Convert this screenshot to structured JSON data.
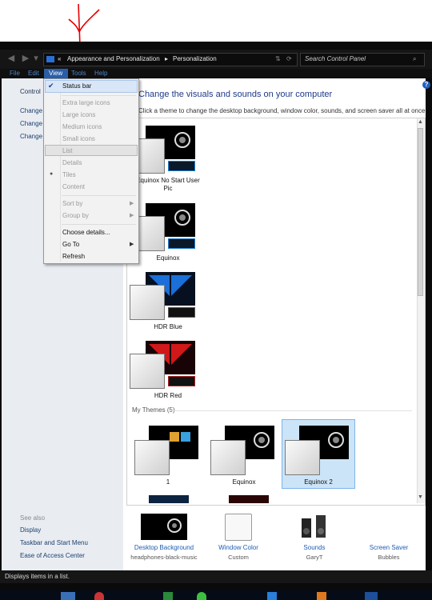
{
  "address": {
    "crumb1": "Appearance and Personalization",
    "crumb2": "Personalization",
    "search_placeholder": "Search Control Panel"
  },
  "menubar": {
    "file": "File",
    "edit": "Edit",
    "view": "View",
    "tools": "Tools",
    "help": "Help"
  },
  "left_pane": {
    "control_label": "Control",
    "links": [
      "Change",
      "Change",
      "Change"
    ],
    "see_also": "See also",
    "see_also_links": [
      "Display",
      "Taskbar and Start Menu",
      "Ease of Access Center"
    ]
  },
  "main": {
    "title": "Change the visuals and sounds on your computer",
    "subtitle": "Click a theme to change the desktop background, window color, sounds, and screen saver all at once.",
    "themes": [
      {
        "label_line1": "Equinox No Start User",
        "label_line2": "Pic"
      },
      {
        "label_line1": "Equinox",
        "label_line2": ""
      },
      {
        "label_line1": "HDR Blue",
        "label_line2": ""
      },
      {
        "label_line1": "HDR Red",
        "label_line2": ""
      }
    ],
    "my_themes_label": "My Themes (5)",
    "my_themes": [
      "1",
      "Equinox",
      "Equinox 2"
    ],
    "selected_theme": "Equinox 2"
  },
  "bottom": {
    "desktop_background": {
      "label": "Desktop Background",
      "sub": "headphones-black-music"
    },
    "window_color": {
      "label": "Window Color",
      "sub": "Custom"
    },
    "sounds": {
      "label": "Sounds",
      "sub": "GaryT"
    },
    "screen_saver": {
      "label": "Screen Saver",
      "sub": "Bubbles"
    }
  },
  "view_menu": {
    "status_bar": "Status bar",
    "extra_large_icons": "Extra large icons",
    "large_icons": "Large icons",
    "medium_icons": "Medium icons",
    "small_icons": "Small icons",
    "list": "List",
    "details": "Details",
    "tiles": "Tiles",
    "content": "Content",
    "sort_by": "Sort by",
    "group_by": "Group by",
    "choose_details": "Choose details...",
    "go_to": "Go To",
    "refresh": "Refresh",
    "checked_item": "Status bar",
    "radio_item": "Tiles"
  },
  "status_text": "Displays items in a list.",
  "colors": {
    "annotation": "#e60000",
    "selected_fill": "#cce4f7",
    "link": "#1e5db3"
  }
}
